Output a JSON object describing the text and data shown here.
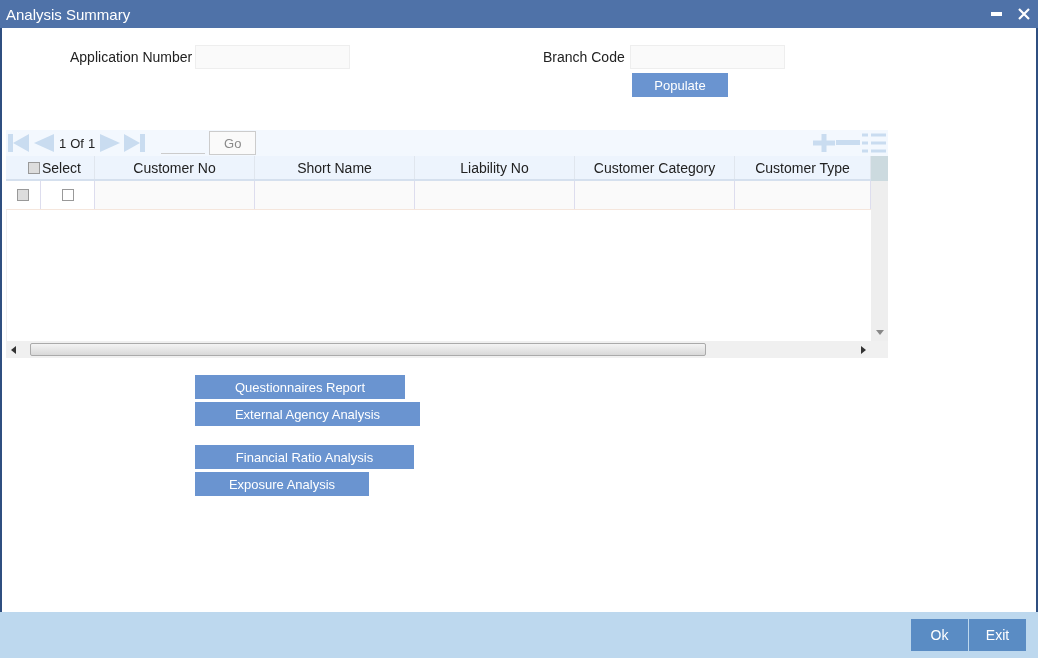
{
  "window": {
    "title": "Analysis Summary"
  },
  "fields": [
    {
      "label": "Application Number"
    },
    {
      "label": "Branch Code"
    }
  ],
  "populate_button": {
    "label": "Populate"
  },
  "grid": {
    "pager": {
      "current": "1",
      "of": "Of",
      "total": "1",
      "go": {
        "label": "Go",
        "disabled": true
      }
    },
    "select_all": {
      "checked": false
    },
    "columns": [
      "Select",
      "Customer No",
      "Short Name",
      "Liability No",
      "Customer Category",
      "Customer Type"
    ],
    "rows": [
      {
        "marked": false,
        "selected": false
      }
    ]
  },
  "analysis_buttons": [
    {
      "label": "Questionnaires Report"
    },
    {
      "label": "External Agency Analysis"
    },
    {
      "label": "Financial Ratio Analysis"
    },
    {
      "label": "Exposure Analysis"
    }
  ],
  "footer_buttons": [
    "Ok",
    "Exit"
  ]
}
